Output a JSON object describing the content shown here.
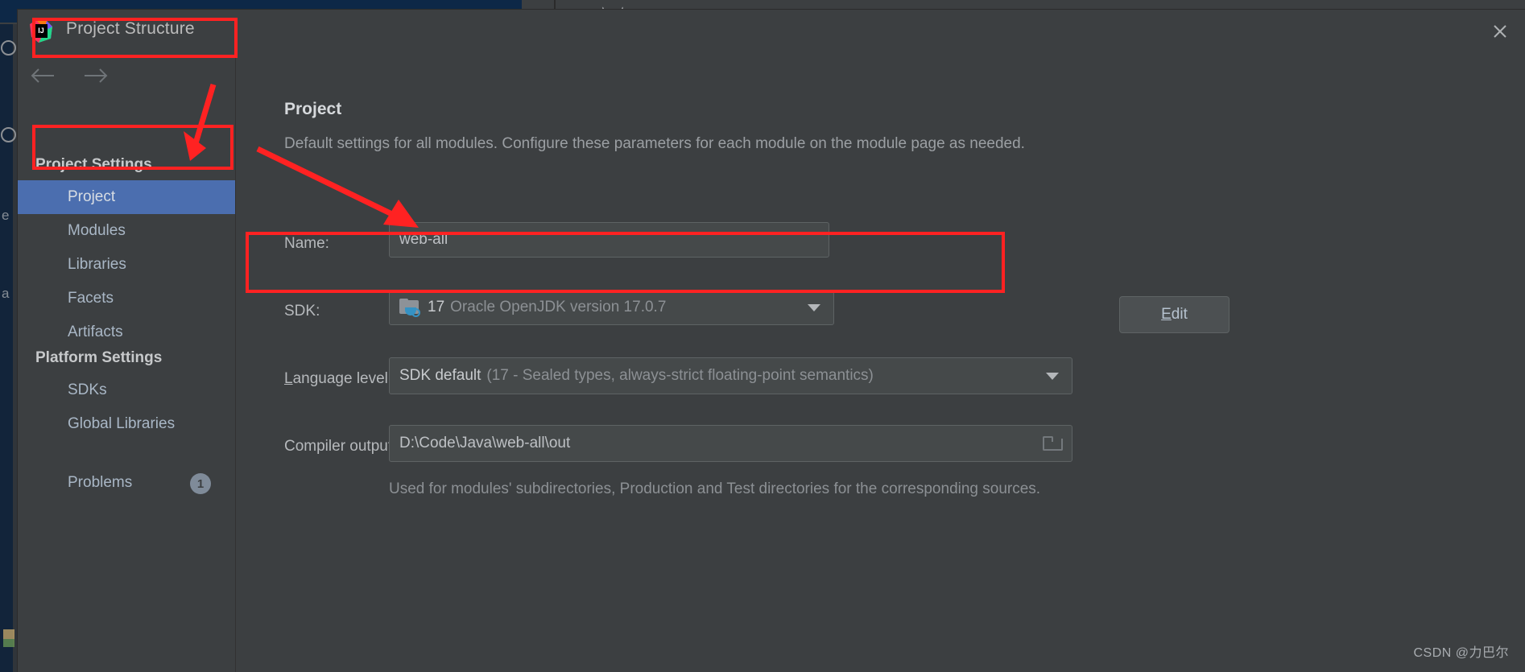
{
  "window": {
    "title": "Project Structure",
    "close_icon": "close-icon",
    "app_icon": "intellij-idea-icon"
  },
  "nav": {
    "back_icon": "arrow-left-icon",
    "forward_icon": "arrow-right-icon"
  },
  "sidebar": {
    "sections": [
      {
        "header": "Project Settings",
        "items": [
          {
            "label": "Project",
            "selected": true
          },
          {
            "label": "Modules",
            "selected": false
          },
          {
            "label": "Libraries",
            "selected": false
          },
          {
            "label": "Facets",
            "selected": false
          },
          {
            "label": "Artifacts",
            "selected": false
          }
        ]
      },
      {
        "header": "Platform Settings",
        "items": [
          {
            "label": "SDKs",
            "selected": false
          },
          {
            "label": "Global Libraries",
            "selected": false
          }
        ]
      }
    ],
    "problems": {
      "label": "Problems",
      "count": "1"
    }
  },
  "main": {
    "title": "Project",
    "description": "Default settings for all modules. Configure these parameters for each module on the module page as needed.",
    "fields": {
      "name": {
        "label": "Name:",
        "value": "web-all"
      },
      "sdk": {
        "label": "SDK:",
        "icon": "jdk-folder-icon",
        "version": "17",
        "vendor_text": "Oracle OpenJDK version 17.0.7",
        "dropdown_icon": "chevron-down-icon",
        "edit_button": {
          "mnemonic": "E",
          "rest": "dit"
        }
      },
      "language_level": {
        "label_mnemonic": "L",
        "label_rest": "anguage level:",
        "value_strong": "SDK default",
        "value_dim": "(17 - Sealed types, always-strict floating-point semantics)",
        "dropdown_icon": "chevron-down-icon"
      },
      "compiler_output": {
        "label": "Compiler output:",
        "value": "D:\\Code\\Java\\web-all\\out",
        "browse_icon": "folder-browse-icon",
        "hint": "Used for modules' subdirectories, Production and Test directories for the corresponding sources."
      }
    }
  },
  "annotations": {
    "color": "#ff2222",
    "rects": [
      {
        "name": "title-highlight"
      },
      {
        "name": "project-item-highlight"
      },
      {
        "name": "sdk-row-highlight"
      }
    ],
    "arrows": [
      {
        "name": "arrow-to-project-item"
      },
      {
        "name": "arrow-to-sdk-row"
      }
    ]
  },
  "watermark": {
    "text": "CSDN @力巴尔"
  }
}
